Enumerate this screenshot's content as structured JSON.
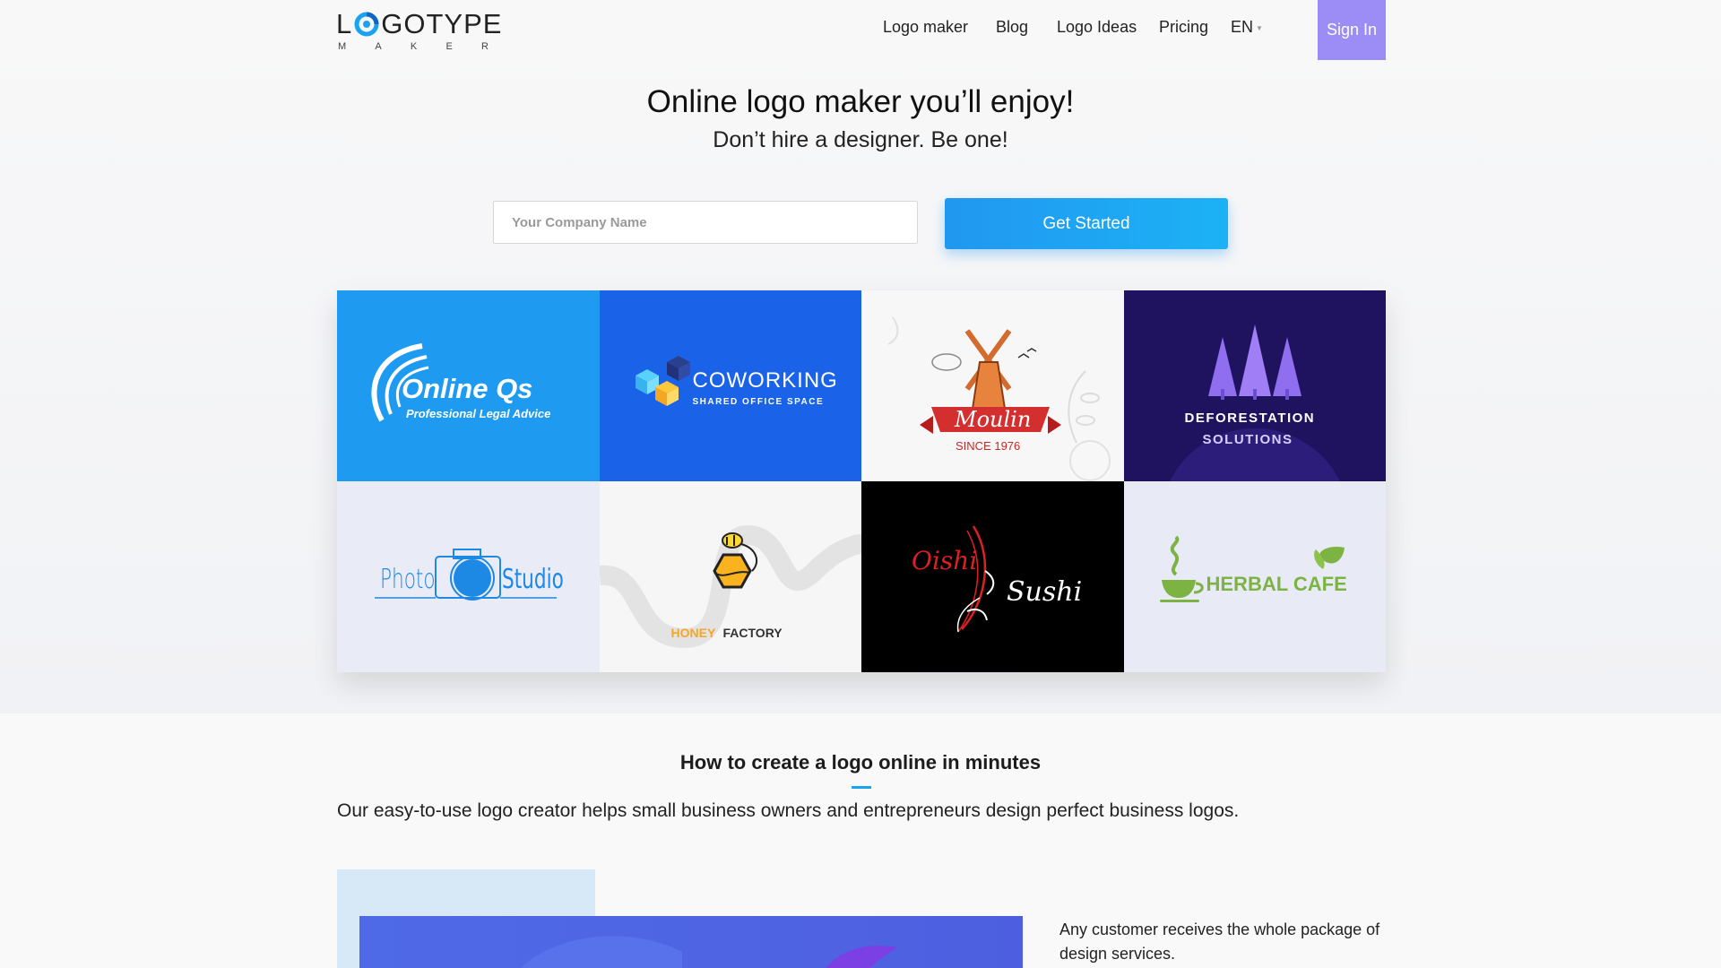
{
  "header": {
    "logo_word_left": "L",
    "logo_word_right": "GOTYPE",
    "logo_sub_letters": [
      "M",
      "A",
      "K",
      "E",
      "R"
    ],
    "nav": [
      {
        "label": "Logo maker"
      },
      {
        "label": "Blog"
      },
      {
        "label": "Logo Ideas"
      },
      {
        "label": "Pricing"
      },
      {
        "label": "EN"
      }
    ],
    "signin_label": "Sign In"
  },
  "hero": {
    "title": "Online logo maker you’ll enjoy!",
    "subtitle": "Don’t hire a designer. Be one!",
    "input_placeholder": "Your Company Name",
    "cta_label": "Get Started"
  },
  "logos": [
    {
      "name": "Online Qs",
      "tagline": "Professional Legal Advice",
      "bg": "#1e9bf0"
    },
    {
      "name": "COWORKING",
      "tagline": "SHARED OFFICE SPACE",
      "bg": "#1a63e8"
    },
    {
      "name": "Moulin",
      "tagline": "SINCE 1976",
      "bg": "#f7f7f7"
    },
    {
      "name": "Deforestation",
      "tagline": "Solutions",
      "bg": "#1f1360"
    },
    {
      "name": "Photo",
      "tagline": "Studio",
      "bg": "#e9ecf6"
    },
    {
      "name": "HONEY",
      "tagline": "FACTORY",
      "bg": "#f6f6f6"
    },
    {
      "name": "Oishi",
      "tagline": "Sushi",
      "bg": "#000000"
    },
    {
      "name": "HERBAL CAFE",
      "tagline": "",
      "bg": "#e8eaf6"
    }
  ],
  "how": {
    "title": "How to create a logo online in minutes",
    "description": "Our easy-to-use logo creator helps small business owners and entrepreneurs design perfect business logos.",
    "customer_text": "Any customer receives the whole package of design services."
  },
  "colors": {
    "accent": "#1aa3f0",
    "signin_bg": "#9b8cf6"
  }
}
